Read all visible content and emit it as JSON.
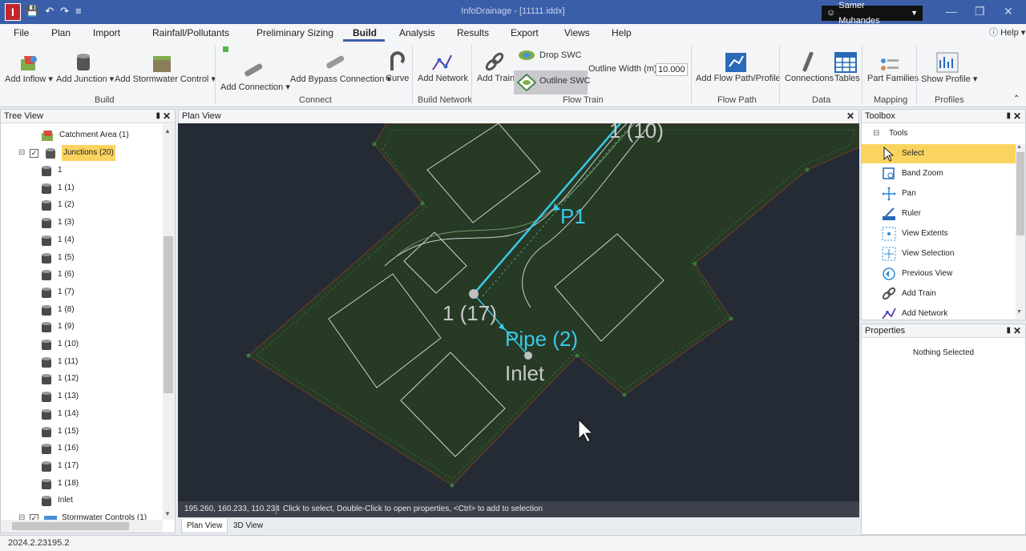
{
  "window": {
    "title": "InfoDrainage - [11111.iddx]",
    "user": "Samer Muhandes"
  },
  "menu": {
    "items": [
      "File",
      "Plan",
      "Import",
      "Rainfall/Pollutants",
      "Preliminary Sizing",
      "Build",
      "Analysis",
      "Results",
      "Export",
      "Views",
      "Help"
    ],
    "active": "Build",
    "help_label": "Help"
  },
  "ribbon": {
    "add_inflow": "Add Inflow",
    "add_junction": "Add Junction",
    "add_stormwater_control": "Add Stormwater Control",
    "group_build": "Build",
    "add_connection": "Add Connection",
    "add_bypass_connection": "Add Bypass Connection",
    "curve": "Curve",
    "group_connect": "Connect",
    "add_network": "Add Network",
    "group_build_network": "Build Network",
    "add_train": "Add Train",
    "drop_swc": "Drop SWC",
    "outline_swc": "Outline SWC",
    "outline_width_label": "Outline Width (m)",
    "outline_width_value": "10.000",
    "group_flow_train": "Flow Train",
    "add_flow_path": "Add Flow Path/Profile",
    "group_flow_path": "Flow Path",
    "connections": "Connections",
    "tables": "Tables",
    "group_data": "Data",
    "part_families": "Part Families",
    "group_mapping": "Mapping",
    "show_profile": "Show Profile",
    "group_profiles": "Profiles"
  },
  "tree": {
    "title": "Tree View",
    "catchment": "Catchment Area (1)",
    "junctions": "Junctions (20)",
    "items": [
      "1",
      "1 (1)",
      "1 (2)",
      "1 (3)",
      "1 (4)",
      "1 (5)",
      "1 (6)",
      "1 (7)",
      "1 (8)",
      "1 (9)",
      "1 (10)",
      "1 (11)",
      "1 (12)",
      "1 (13)",
      "1 (14)",
      "1 (15)",
      "1 (16)",
      "1 (17)",
      "1 (18)",
      "Inlet"
    ],
    "stormwater": "Stormwater Controls (1)"
  },
  "plan": {
    "title": "Plan View",
    "labels": {
      "top_node": "1 (10)",
      "pipe1": "P1",
      "node17": "1 (17)",
      "pipe2": "Pipe (2)",
      "inlet": "Inlet"
    },
    "status_coords": "195.260, 160.233, 110.234",
    "status_hint": "Click to select, Double-Click to open properties, <Ctrl> to add to selection",
    "tabs": [
      "Plan View",
      "3D View"
    ],
    "active_tab": "Plan View"
  },
  "toolbox": {
    "title": "Toolbox",
    "section": "Tools",
    "tools": [
      "Select",
      "Band Zoom",
      "Pan",
      "Ruler",
      "View Extents",
      "View Selection",
      "Previous View",
      "Add Train",
      "Add Network"
    ],
    "selected": "Select"
  },
  "properties": {
    "title": "Properties",
    "empty": "Nothing Selected"
  },
  "version": "2024.2.23195.2",
  "colors": {
    "title_bar": "#3b5ea8",
    "canvas": "#252b35",
    "site": "#263a26",
    "pipe": "#3ac8e8",
    "selection": "#fbd460"
  }
}
